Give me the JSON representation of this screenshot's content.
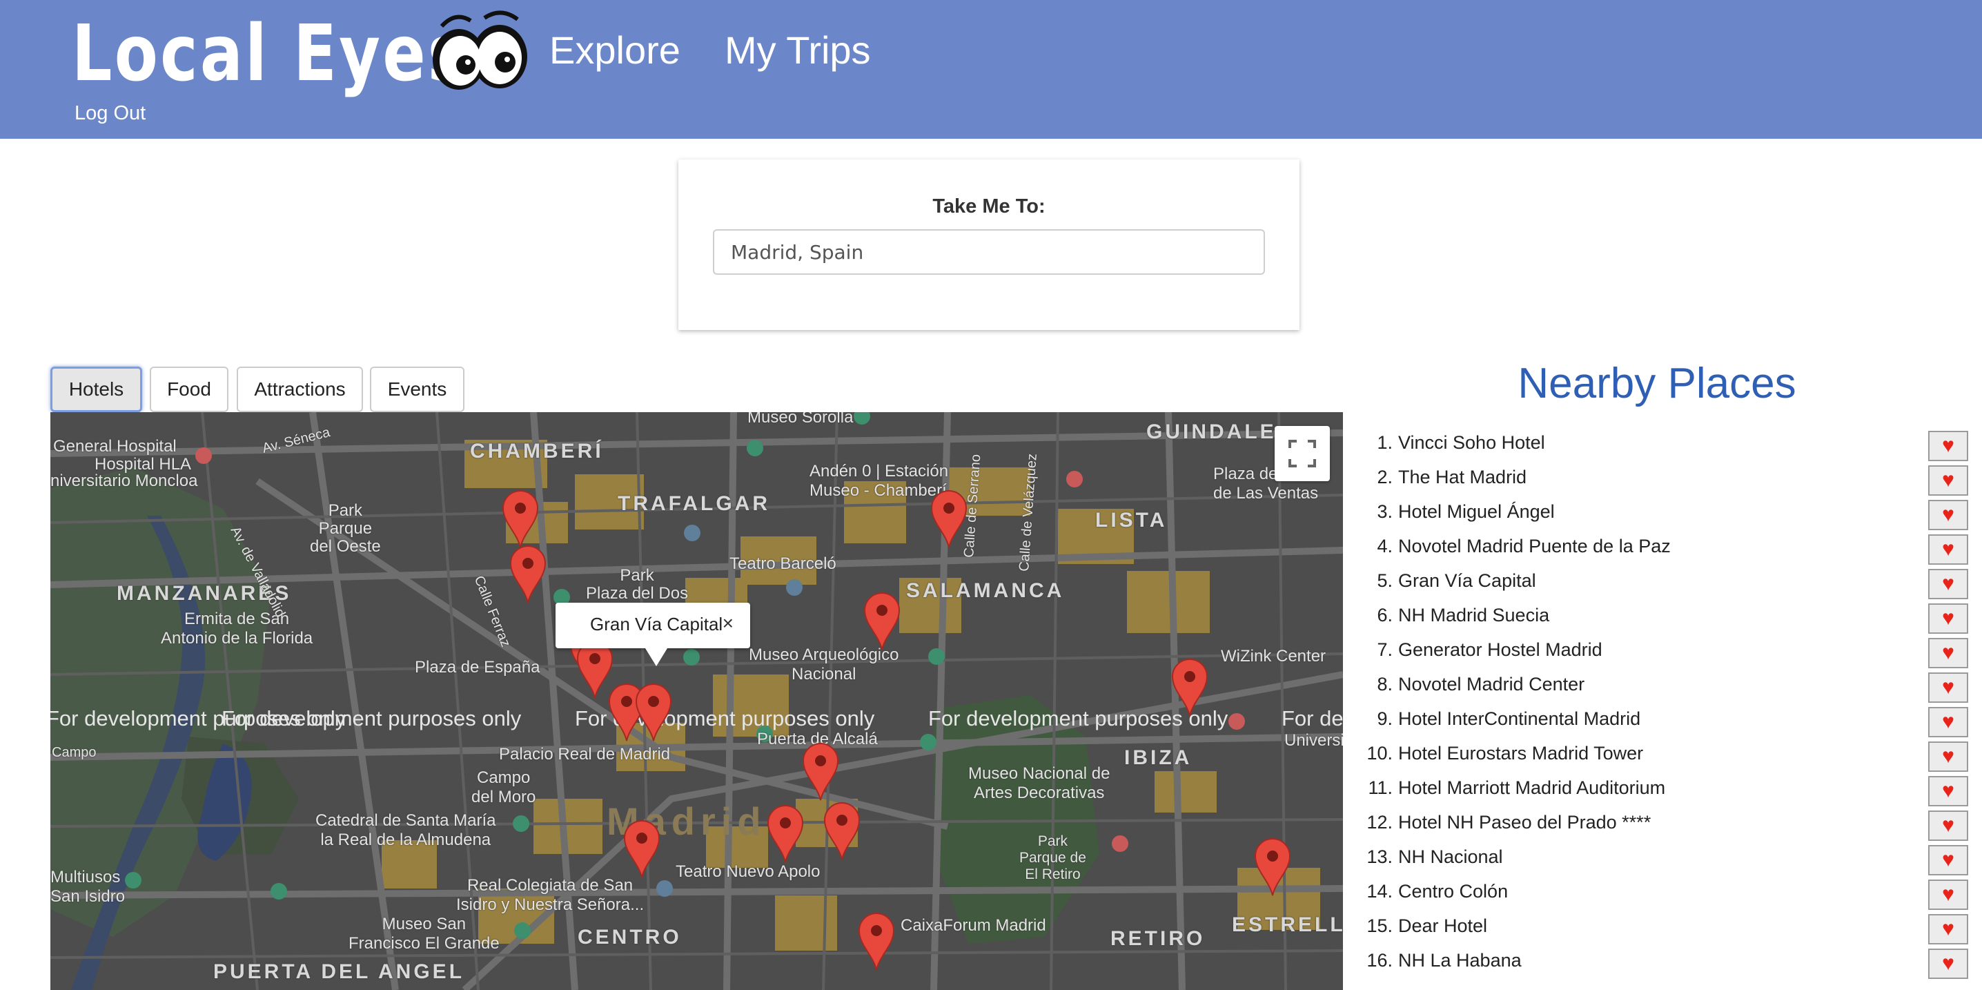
{
  "header": {
    "logo": "Local Eyes",
    "nav": {
      "explore": "Explore",
      "my_trips": "My Trips"
    },
    "logout": "Log Out",
    "color": "#6b87c9"
  },
  "search": {
    "label": "Take Me To:",
    "value": "Madrid, Spain"
  },
  "categories": {
    "hotels": "Hotels",
    "food": "Food",
    "attractions": "Attractions",
    "events": "Events",
    "active": "Hotels"
  },
  "map": {
    "labels": {
      "chamberi": "CHAMBERÍ",
      "trafalgar": "TRAFALGAR",
      "salamanca": "SALAMANCA",
      "lista": "LISTA",
      "guindalera": "GUINDALE",
      "manzanares": "MANZANARES",
      "ibiza": "IBIZA",
      "retiro": "RETIRO",
      "centro": "CENTRO",
      "madrid": "Madrid",
      "estrella": "ESTRELLA",
      "puerta_angel": "PUERTA DEL ANGEL",
      "museo_sorolla": "Museo Sorolla",
      "general_hospital": "General Hospital",
      "hospital_hla": "Hospital HLA",
      "universitario_moncloa": "niversitario Moncloa",
      "av_seneca": "Av. Séneca",
      "park_oeste": "Park\nParque\ndel Oeste",
      "andén": "Andén 0 | Estación\nMuseo - Chamberí",
      "teatro_barcelo": "Teatro Barceló",
      "park_dos": "Park\nPlaza del Dos",
      "plaza_espana": "Plaza de España",
      "ermita": "Ermita de San\nAntonio de la Florida",
      "museo_arq": "Museo Arqueológico\nNacional",
      "wizink": "WiZink Center",
      "plaza_ventas": "Plaza de\nde Las Ventas",
      "palacio": "Palacio Real de Madrid",
      "puerta_alcala": "Puerta de Alcalá",
      "campo_moro": "Campo\ndel Moro",
      "campo": "Campo",
      "catedral": "Catedral de Santa María\nla Real de la Almudena",
      "museo_artes": "Museo Nacional de\nArtes Decorativas",
      "park_retiro": "Park\nParque de\nEl Retiro",
      "teatro_apolo": "Teatro Nuevo Apolo",
      "multiusos": "Multiusos\nSan Isidro",
      "real_colegiata": "Real Colegiata de San\nIsidro y Nuestra Señora...",
      "museo_francisco": "Museo San\nFrancisco El Grande",
      "caixaforum": "CaixaForum Madrid",
      "university_hospital": "University H",
      "calle_velazquez": "Calle de Velázquez",
      "calle_serrano": "Calle de Serrano",
      "calle_ferraz": "Calle Ferraz",
      "av_valladolid": "Av. de Valladolid"
    },
    "watermark": "For development purposes only",
    "infowindow": {
      "title": "Gran Vía Capital",
      "close": "×"
    }
  },
  "nearby": {
    "title": "Nearby Places",
    "places": [
      {
        "num": "1.",
        "name": "Vincci Soho Hotel"
      },
      {
        "num": "2.",
        "name": "The Hat Madrid"
      },
      {
        "num": "3.",
        "name": "Hotel Miguel Ángel"
      },
      {
        "num": "4.",
        "name": "Novotel Madrid Puente de la Paz"
      },
      {
        "num": "5.",
        "name": "Gran Vía Capital"
      },
      {
        "num": "6.",
        "name": "NH Madrid Suecia"
      },
      {
        "num": "7.",
        "name": "Generator Hostel Madrid"
      },
      {
        "num": "8.",
        "name": "Novotel Madrid Center"
      },
      {
        "num": "9.",
        "name": "Hotel InterContinental Madrid"
      },
      {
        "num": "10.",
        "name": "Hotel Eurostars Madrid Tower"
      },
      {
        "num": "11.",
        "name": "Hotel Marriott Madrid Auditorium"
      },
      {
        "num": "12.",
        "name": "Hotel NH Paseo del Prado ****"
      },
      {
        "num": "13.",
        "name": "NH Nacional"
      },
      {
        "num": "14.",
        "name": "Centro Colón"
      },
      {
        "num": "15.",
        "name": "Dear Hotel"
      },
      {
        "num": "16.",
        "name": "NH La Habana"
      }
    ],
    "fav_icon": "heart-icon",
    "title_color": "#2f5fb5"
  }
}
